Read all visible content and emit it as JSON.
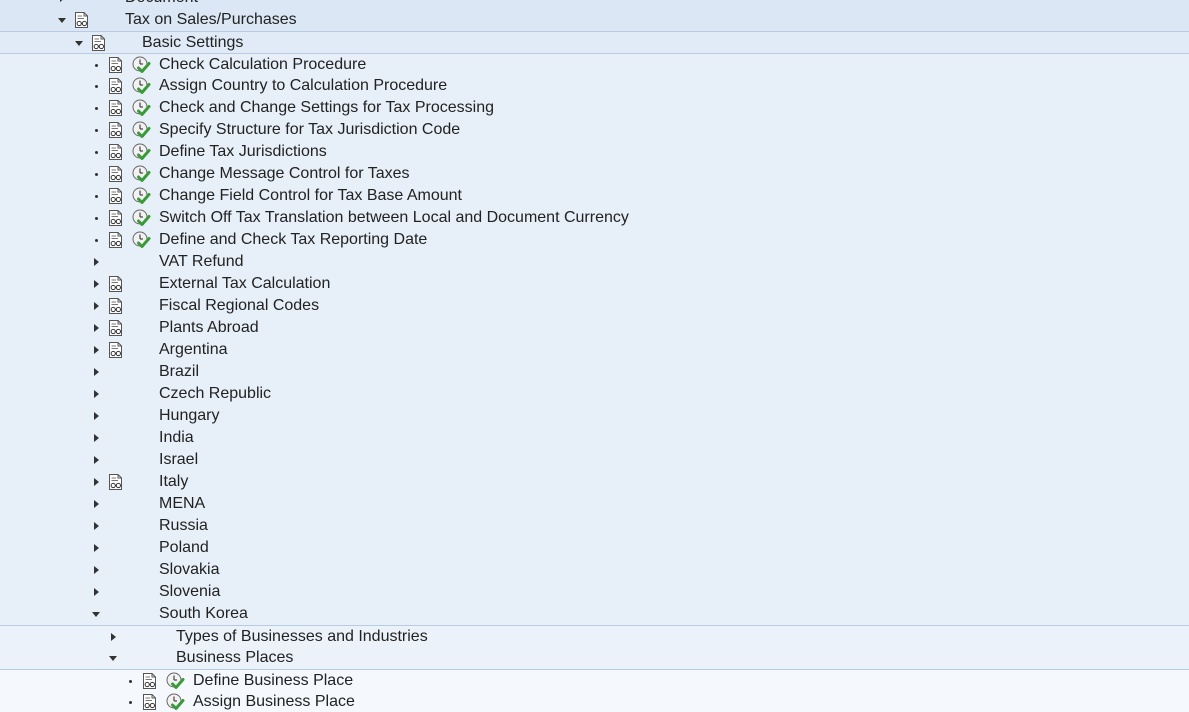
{
  "colors": {
    "level_0": "#dbe7f4",
    "level_1": "#e1ebf7",
    "level_2": "#e7eff9",
    "level_3": "#ecf2fa",
    "level_4": "#f5f8fc",
    "divider": "#b8cbe0",
    "text": "#222222",
    "check_green": "#3a9a3a"
  },
  "icons": {
    "expand_open": "triangle-down-icon",
    "expand_closed": "triangle-right-icon",
    "leaf": "bullet-icon",
    "documentation": "document-glasses-icon",
    "execute": "clock-check-icon"
  },
  "tree": [
    {
      "label": "Document",
      "level": 0,
      "toggle": "collapsed",
      "doc_icon": false,
      "exec_icon": false
    },
    {
      "label": "Tax on Sales/Purchases",
      "level": 0,
      "toggle": "expanded",
      "doc_icon": true,
      "exec_icon": false
    },
    {
      "label": "Basic Settings",
      "level": 1,
      "toggle": "expanded",
      "doc_icon": true,
      "exec_icon": false
    },
    {
      "label": "Check Calculation Procedure",
      "level": 2,
      "toggle": "leaf",
      "doc_icon": true,
      "exec_icon": true
    },
    {
      "label": "Assign Country to Calculation Procedure",
      "level": 2,
      "toggle": "leaf",
      "doc_icon": true,
      "exec_icon": true
    },
    {
      "label": "Check and Change Settings for Tax Processing",
      "level": 2,
      "toggle": "leaf",
      "doc_icon": true,
      "exec_icon": true
    },
    {
      "label": "Specify Structure for Tax Jurisdiction Code",
      "level": 2,
      "toggle": "leaf",
      "doc_icon": true,
      "exec_icon": true
    },
    {
      "label": "Define Tax Jurisdictions",
      "level": 2,
      "toggle": "leaf",
      "doc_icon": true,
      "exec_icon": true
    },
    {
      "label": "Change Message Control for Taxes",
      "level": 2,
      "toggle": "leaf",
      "doc_icon": true,
      "exec_icon": true
    },
    {
      "label": "Change Field Control for Tax Base Amount",
      "level": 2,
      "toggle": "leaf",
      "doc_icon": true,
      "exec_icon": true
    },
    {
      "label": "Switch Off Tax Translation between Local and Document Currency",
      "level": 2,
      "toggle": "leaf",
      "doc_icon": true,
      "exec_icon": true
    },
    {
      "label": "Define and Check Tax Reporting Date",
      "level": 2,
      "toggle": "leaf",
      "doc_icon": true,
      "exec_icon": true
    },
    {
      "label": "VAT Refund",
      "level": 2,
      "toggle": "collapsed",
      "doc_icon": false,
      "exec_icon": false
    },
    {
      "label": "External Tax Calculation",
      "level": 2,
      "toggle": "collapsed",
      "doc_icon": true,
      "exec_icon": false
    },
    {
      "label": "Fiscal Regional Codes",
      "level": 2,
      "toggle": "collapsed",
      "doc_icon": true,
      "exec_icon": false
    },
    {
      "label": "Plants Abroad",
      "level": 2,
      "toggle": "collapsed",
      "doc_icon": true,
      "exec_icon": false
    },
    {
      "label": "Argentina",
      "level": 2,
      "toggle": "collapsed",
      "doc_icon": true,
      "exec_icon": false
    },
    {
      "label": "Brazil",
      "level": 2,
      "toggle": "collapsed",
      "doc_icon": false,
      "exec_icon": false
    },
    {
      "label": "Czech Republic",
      "level": 2,
      "toggle": "collapsed",
      "doc_icon": false,
      "exec_icon": false
    },
    {
      "label": "Hungary",
      "level": 2,
      "toggle": "collapsed",
      "doc_icon": false,
      "exec_icon": false
    },
    {
      "label": "India",
      "level": 2,
      "toggle": "collapsed",
      "doc_icon": false,
      "exec_icon": false
    },
    {
      "label": "Israel",
      "level": 2,
      "toggle": "collapsed",
      "doc_icon": false,
      "exec_icon": false
    },
    {
      "label": "Italy",
      "level": 2,
      "toggle": "collapsed",
      "doc_icon": true,
      "exec_icon": false
    },
    {
      "label": "MENA",
      "level": 2,
      "toggle": "collapsed",
      "doc_icon": false,
      "exec_icon": false
    },
    {
      "label": "Russia",
      "level": 2,
      "toggle": "collapsed",
      "doc_icon": false,
      "exec_icon": false
    },
    {
      "label": "Poland",
      "level": 2,
      "toggle": "collapsed",
      "doc_icon": false,
      "exec_icon": false
    },
    {
      "label": "Slovakia",
      "level": 2,
      "toggle": "collapsed",
      "doc_icon": false,
      "exec_icon": false
    },
    {
      "label": "Slovenia",
      "level": 2,
      "toggle": "collapsed",
      "doc_icon": false,
      "exec_icon": false
    },
    {
      "label": "South Korea",
      "level": 2,
      "toggle": "expanded",
      "doc_icon": false,
      "exec_icon": false
    },
    {
      "label": "Types of Businesses and Industries",
      "level": 3,
      "toggle": "collapsed",
      "doc_icon": false,
      "exec_icon": false
    },
    {
      "label": "Business Places",
      "level": 3,
      "toggle": "expanded",
      "doc_icon": false,
      "exec_icon": false
    },
    {
      "label": "Define Business Place",
      "level": 4,
      "toggle": "leaf",
      "doc_icon": true,
      "exec_icon": true
    },
    {
      "label": "Assign Business Place",
      "level": 4,
      "toggle": "leaf",
      "doc_icon": true,
      "exec_icon": true
    }
  ]
}
